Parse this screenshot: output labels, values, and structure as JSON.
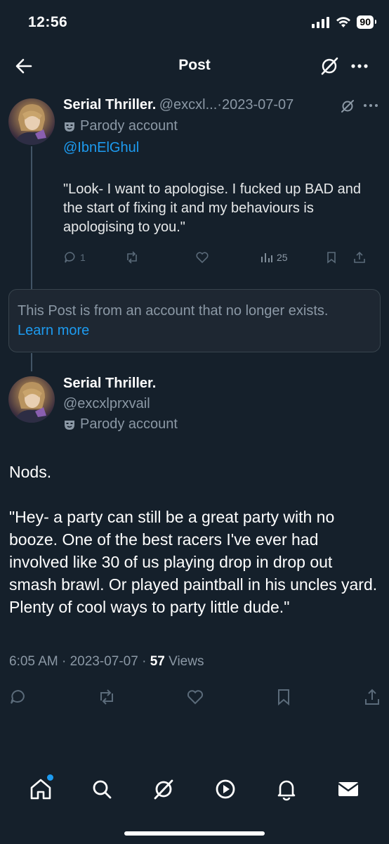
{
  "status_bar": {
    "time": "12:56",
    "battery": "90"
  },
  "header": {
    "title": "Post"
  },
  "reply_tweet": {
    "name": "Serial Thriller.",
    "handle": "@excxl...",
    "date_sep": "·",
    "date": "2023-07-07",
    "parody_label": "Parody account",
    "mention": "@IbnElGhul",
    "text": "\"Look- I want to apologise. I fucked up BAD and the start of fixing it and my behaviours is apologising to you.\"",
    "replies": "1",
    "views": "25"
  },
  "notice": {
    "text": "This Post is from an account that no longer exists.",
    "link": "Learn more"
  },
  "main_tweet": {
    "name": "Serial Thriller.",
    "handle": "@excxlprxvail",
    "parody_label": "Parody account",
    "text_line1": "Nods.",
    "text_line2": "\"Hey- a party can still be a great party with no booze. One of the best racers I've ever had involved like 30 of us playing drop in drop out smash brawl. Or played paintball in his uncles yard. Plenty of cool ways to party little dude.\"",
    "time": "6:05 AM",
    "sep": "·",
    "date": "2023-07-07",
    "views_count": "57",
    "views_label": "Views"
  },
  "tabbar": {
    "items": [
      "home-icon",
      "search-icon",
      "grok-icon",
      "video-icon",
      "notifications-icon",
      "messages-icon"
    ]
  },
  "colors": {
    "background": "#15202b",
    "accent": "#1d9bf0",
    "muted": "#8b98a5"
  }
}
